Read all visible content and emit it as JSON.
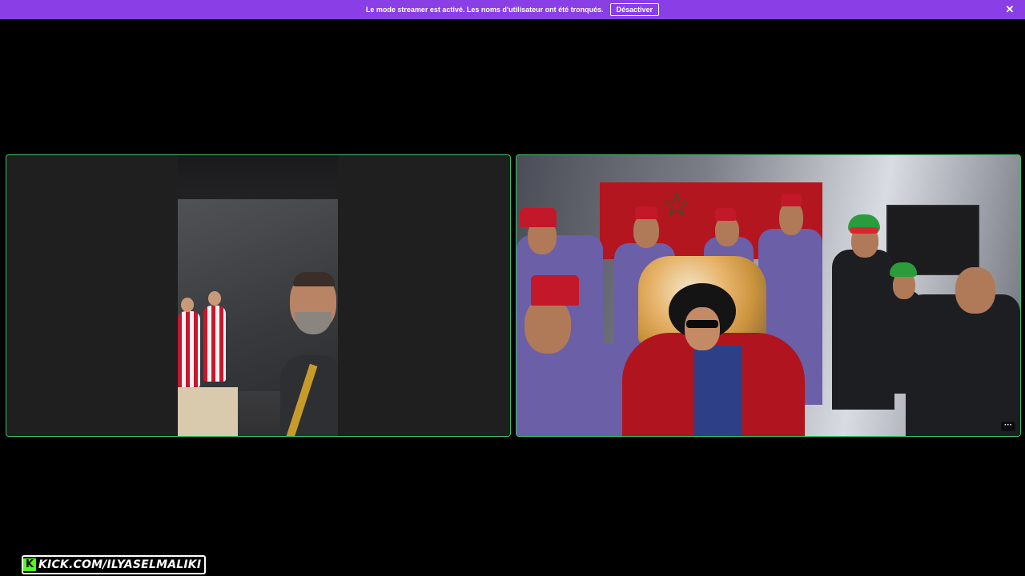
{
  "banner": {
    "message": "Le mode streamer est activé. Les noms d'utilisateur ont été tronqués.",
    "disable_label": "Désactiver",
    "close_icon": "close-icon",
    "background_color": "#8a3fe6"
  },
  "tiles": {
    "left": {
      "border_color": "#3fbf6a"
    },
    "right": {
      "more_label": "···",
      "border_color": "#3fbf6a"
    }
  },
  "watermark": {
    "logo_letter": "K",
    "text": "KICK.COM/ILYASELMALIKI",
    "logo_color": "#53fc18"
  }
}
